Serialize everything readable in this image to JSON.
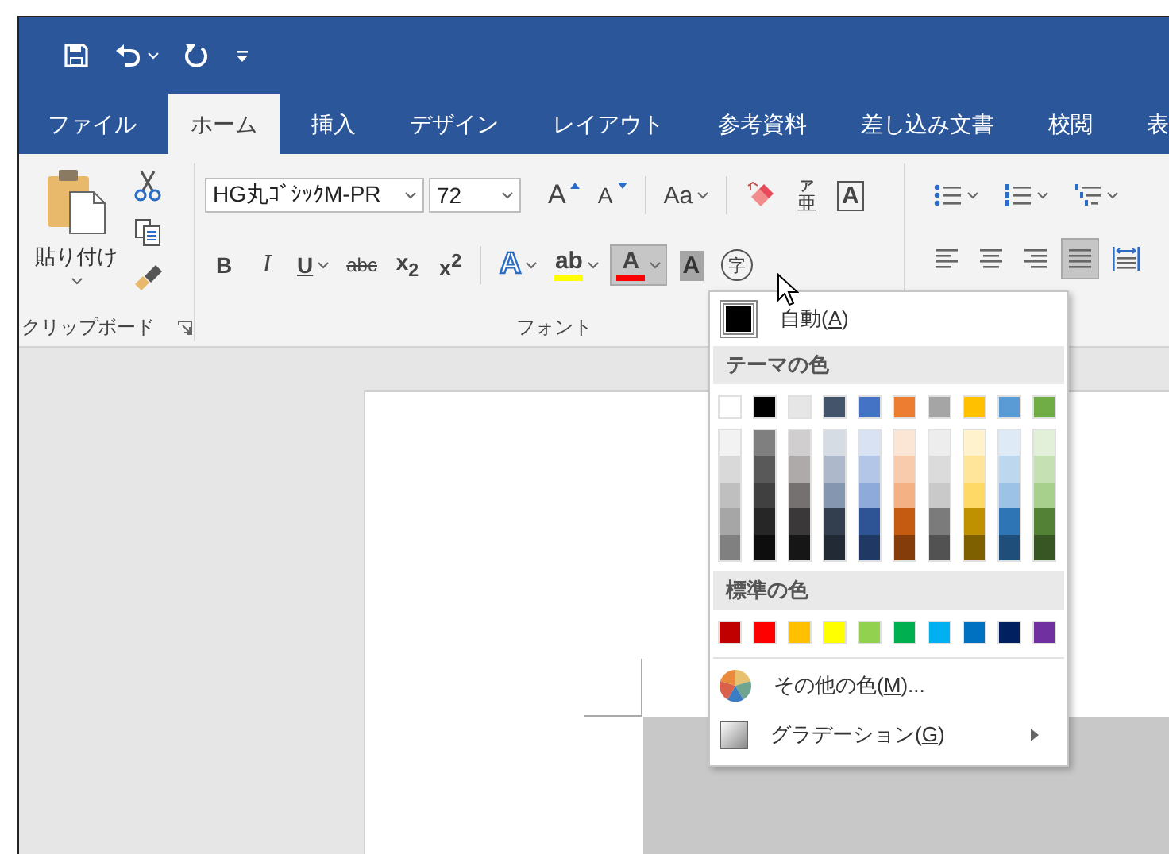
{
  "quick_access": [
    {
      "kind": "save",
      "dropdown": false
    },
    {
      "kind": "undo",
      "dropdown": true
    },
    {
      "kind": "redo",
      "dropdown": false
    },
    {
      "kind": "customize",
      "dropdown": false
    }
  ],
  "tabs": [
    {
      "label": "ファイル",
      "selected": false
    },
    {
      "label": "ホーム",
      "selected": true
    },
    {
      "label": "挿入",
      "selected": false
    },
    {
      "label": "デザイン",
      "selected": false
    },
    {
      "label": "レイアウト",
      "selected": false
    },
    {
      "label": "参考資料",
      "selected": false
    },
    {
      "label": "差し込み文書",
      "selected": false
    },
    {
      "label": "校閲",
      "selected": false
    },
    {
      "label": "表",
      "selected": false
    }
  ],
  "ribbon": {
    "clipboard": {
      "paste_label": "貼り付け",
      "group_label": "クリップボード"
    },
    "font": {
      "font_name": "HG丸ｺﾞｼｯｸM-PR",
      "font_size": "72",
      "group_label": "フォント",
      "row1": [
        {
          "kind": "grow",
          "label": "A"
        },
        {
          "kind": "shrink",
          "label": "A"
        },
        {
          "kind": "sep"
        },
        {
          "kind": "case",
          "label": "Aa",
          "dropdown": true
        },
        {
          "kind": "sep"
        },
        {
          "kind": "clear"
        },
        {
          "kind": "phonetic",
          "label": "亜",
          "ruby": "ア"
        },
        {
          "kind": "border",
          "label": "A"
        }
      ],
      "row2": [
        {
          "kind": "bold",
          "label": "B"
        },
        {
          "kind": "italic",
          "label": "I"
        },
        {
          "kind": "underline",
          "label": "U",
          "dropdown": true
        },
        {
          "kind": "strike",
          "label": "abc"
        },
        {
          "kind": "subscript",
          "label": "x$_{2}$"
        },
        {
          "kind": "superscript",
          "label": "x$^{2}$"
        },
        {
          "kind": "sep"
        },
        {
          "kind": "effects",
          "label": "A",
          "dropdown": true
        },
        {
          "kind": "highlight",
          "label": "ab",
          "color": "#ffff00",
          "dropdown": true
        },
        {
          "kind": "font_color",
          "label": "A",
          "color": "#ff0000",
          "dropdown": true,
          "pressed": true
        },
        {
          "kind": "shading",
          "label": "A"
        },
        {
          "kind": "enclose",
          "label": "字"
        }
      ]
    },
    "paragraph": {
      "row1": [
        {
          "kind": "bullets",
          "dropdown": true
        },
        {
          "kind": "numbering",
          "dropdown": true
        },
        {
          "kind": "multilevel",
          "dropdown": true
        }
      ],
      "row2": [
        {
          "kind": "align_left",
          "selected": false
        },
        {
          "kind": "align_center",
          "selected": false
        },
        {
          "kind": "align_right",
          "selected": false
        },
        {
          "kind": "justify",
          "selected": true
        },
        {
          "kind": "distribute",
          "selected": false
        }
      ]
    }
  },
  "color_menu": {
    "automatic": {
      "color": "#000000",
      "label": "自動(",
      "key": "A",
      "label_end": ")"
    },
    "theme_header": "テーマの色",
    "theme_colors": [
      {
        "color": "#ffffff",
        "shades": [
          {
            "color": "#f2f2f2"
          },
          {
            "color": "#d9d9d9"
          },
          {
            "color": "#bfbfbf"
          },
          {
            "color": "#a6a6a6"
          },
          {
            "color": "#808080"
          }
        ]
      },
      {
        "color": "#000000",
        "shades": [
          {
            "color": "#7f7f7f"
          },
          {
            "color": "#595959"
          },
          {
            "color": "#404040"
          },
          {
            "color": "#262626"
          },
          {
            "color": "#0d0d0d"
          }
        ]
      },
      {
        "color": "#e7e6e6",
        "shades": [
          {
            "color": "#d0cece"
          },
          {
            "color": "#aeaaaa"
          },
          {
            "color": "#757171"
          },
          {
            "color": "#3a3838"
          },
          {
            "color": "#171616"
          }
        ]
      },
      {
        "color": "#44546a",
        "shades": [
          {
            "color": "#d6dce4"
          },
          {
            "color": "#adb9ca"
          },
          {
            "color": "#8496b0"
          },
          {
            "color": "#333f4f"
          },
          {
            "color": "#222a35"
          }
        ]
      },
      {
        "color": "#4472c4",
        "shades": [
          {
            "color": "#d9e2f3"
          },
          {
            "color": "#b4c6e7"
          },
          {
            "color": "#8eaadb"
          },
          {
            "color": "#2f5496"
          },
          {
            "color": "#1f3864"
          }
        ]
      },
      {
        "color": "#ed7d31",
        "shades": [
          {
            "color": "#fbe5d5"
          },
          {
            "color": "#f7cbac"
          },
          {
            "color": "#f4b183"
          },
          {
            "color": "#c55a11"
          },
          {
            "color": "#843c0b"
          }
        ]
      },
      {
        "color": "#a5a5a5",
        "shades": [
          {
            "color": "#ededed"
          },
          {
            "color": "#dbdbdb"
          },
          {
            "color": "#c9c9c9"
          },
          {
            "color": "#7b7b7b"
          },
          {
            "color": "#525252"
          }
        ]
      },
      {
        "color": "#ffc000",
        "shades": [
          {
            "color": "#fff2cc"
          },
          {
            "color": "#ffe599"
          },
          {
            "color": "#ffd966"
          },
          {
            "color": "#bf9000"
          },
          {
            "color": "#7f6000"
          }
        ]
      },
      {
        "color": "#5b9bd5",
        "shades": [
          {
            "color": "#deebf6"
          },
          {
            "color": "#bdd7ee"
          },
          {
            "color": "#9cc3e5"
          },
          {
            "color": "#2e75b5"
          },
          {
            "color": "#1e4e79"
          }
        ]
      },
      {
        "color": "#70ad47",
        "shades": [
          {
            "color": "#e2efd9"
          },
          {
            "color": "#c5e0b3"
          },
          {
            "color": "#a8d08d"
          },
          {
            "color": "#538135"
          },
          {
            "color": "#375623"
          }
        ]
      }
    ],
    "standard_header": "標準の色",
    "standard_colors": [
      {
        "color": "#c00000"
      },
      {
        "color": "#ff0000"
      },
      {
        "color": "#ffc000"
      },
      {
        "color": "#ffff00"
      },
      {
        "color": "#92d050"
      },
      {
        "color": "#00b050"
      },
      {
        "color": "#00b0f0"
      },
      {
        "color": "#0070c0"
      },
      {
        "color": "#002060"
      },
      {
        "color": "#7030a0"
      }
    ],
    "items": [
      {
        "kind": "more_colors",
        "label": "その他の色(",
        "key": "M",
        "label_end": ")...",
        "submenu": false
      },
      {
        "kind": "gradient",
        "label": "グラデーション(",
        "key": "G",
        "label_end": ")",
        "submenu": true
      }
    ]
  }
}
